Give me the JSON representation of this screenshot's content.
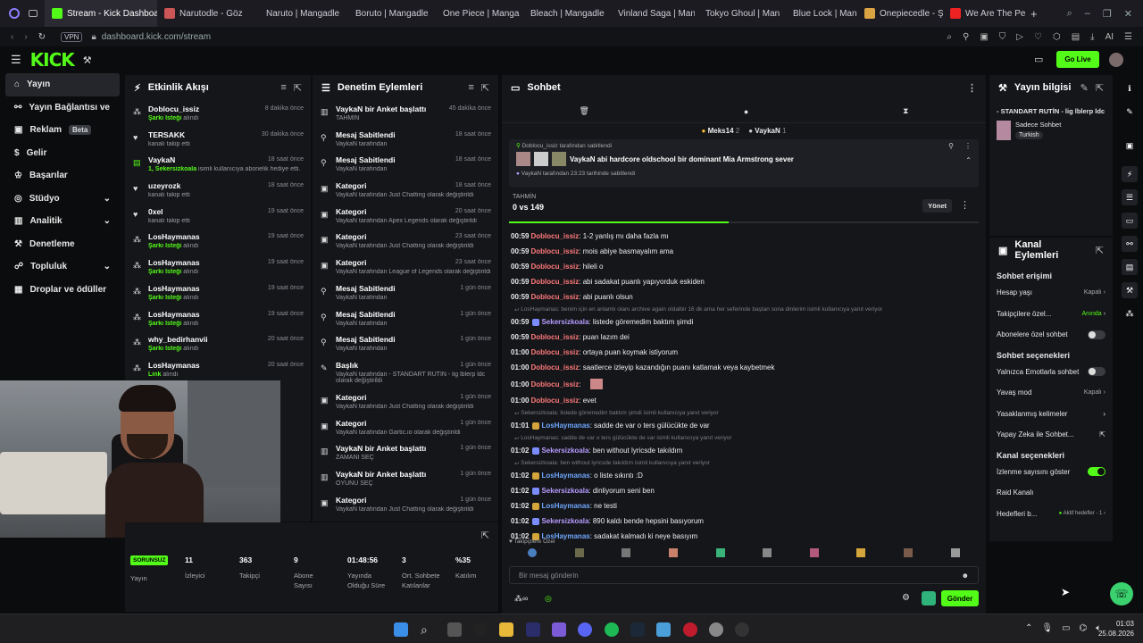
{
  "browser": {
    "tabs": [
      "Stream - Kick Dashboard",
      "Narutodle - Göz",
      "Naruto | Mangadle",
      "Boruto | Mangadle",
      "One Piece | Manga",
      "Bleach | Mangadle",
      "Vinland Saga | Man",
      "Tokyo Ghoul | Man",
      "Blue Lock | Manga",
      "Onepiecedle - Şey",
      "We Are The Pe"
    ],
    "vpn": "VPN",
    "url": "dashboard.kick.com/stream",
    "ai": "AI"
  },
  "header": {
    "logo": "KICK",
    "go_live": "Go Live"
  },
  "sidebar": {
    "items": [
      "Yayın",
      "Yayın Bağlantısı ve Anahtar",
      "Reklam",
      "Gelir",
      "Başarılar",
      "Stüdyo",
      "Analitik",
      "Denetleme",
      "Topluluk",
      "Droplar ve ödüller"
    ],
    "beta": "Beta"
  },
  "activity": {
    "title": "Etkinlik Akışı",
    "rows": [
      {
        "name": "Doblocu_issiz",
        "sub": "Şarkı İsteği",
        "suffix": " alındı",
        "time": "8 dakika önce"
      },
      {
        "name": "TERSAKK",
        "sub": "",
        "suffix": "kanalı takip etti",
        "time": "30 dakika önce"
      },
      {
        "name": "VaykaN",
        "sub": "1, Sekersizkoala",
        "suffix": " isimli kullanıcıya abonelik hediye etti.",
        "time": "18 saat önce"
      },
      {
        "name": "uzeyrozk",
        "sub": "",
        "suffix": "kanalı takip etti",
        "time": "18 saat önce"
      },
      {
        "name": "0xel",
        "sub": "",
        "suffix": "kanalı takip etti",
        "time": "19 saat önce"
      },
      {
        "name": "LosHaymanas",
        "sub": "Şarkı İsteği",
        "suffix": " alındı",
        "time": "19 saat önce"
      },
      {
        "name": "LosHaymanas",
        "sub": "Şarkı İsteği",
        "suffix": " alındı",
        "time": "19 saat önce"
      },
      {
        "name": "LosHaymanas",
        "sub": "Şarkı İsteği",
        "suffix": " alındı",
        "time": "19 saat önce"
      },
      {
        "name": "LosHaymanas",
        "sub": "Şarkı İsteği",
        "suffix": " alındı",
        "time": "19 saat önce"
      },
      {
        "name": "why_bedirhanvii",
        "sub": "Şarkı İsteği",
        "suffix": " alındı",
        "time": "20 saat önce"
      },
      {
        "name": "LosHaymanas",
        "sub": "Link",
        "suffix": " alındı",
        "time": "20 saat önce"
      }
    ]
  },
  "moderation": {
    "title": "Denetim Eylemleri",
    "rows": [
      {
        "title": "VaykaN bir Anket başlattı",
        "sub": "TAHMİN",
        "time": "45 dakika önce"
      },
      {
        "title": "Mesaj Sabitlendi",
        "sub": "VaykaN tarafından",
        "time": "18 saat önce"
      },
      {
        "title": "Mesaj Sabitlendi",
        "sub": "VaykaN tarafından",
        "time": "18 saat önce"
      },
      {
        "title": "Kategori",
        "sub": "VaykaN tarafından Just Chatting olarak değiştirildi",
        "time": "18 saat önce"
      },
      {
        "title": "Kategori",
        "sub": "VaykaN tarafından Apex Legends olarak değiştirildi",
        "time": "20 saat önce"
      },
      {
        "title": "Kategori",
        "sub": "VaykaN tarafından Just Chatting olarak değiştirildi",
        "time": "23 saat önce"
      },
      {
        "title": "Kategori",
        "sub": "VaykaN tarafından League of Legends olarak değiştirildi",
        "time": "23 saat önce"
      },
      {
        "title": "Mesaj Sabitlendi",
        "sub": "VaykaN tarafından",
        "time": "1 gün önce"
      },
      {
        "title": "Mesaj Sabitlendi",
        "sub": "VaykaN tarafından",
        "time": "1 gün önce"
      },
      {
        "title": "Mesaj Sabitlendi",
        "sub": "VaykaN tarafından",
        "time": "1 gün önce"
      },
      {
        "title": "Başlık",
        "sub": "VaykaN tarafından - STANDART RUTİN - lig lblerp ldc olarak değiştirildi",
        "time": "1 gün önce"
      },
      {
        "title": "Kategori",
        "sub": "VaykaN tarafından Just Chatting olarak değiştirildi",
        "time": "1 gün önce"
      },
      {
        "title": "Kategori",
        "sub": "VaykaN tarafından Gartic.io olarak değiştirildi",
        "time": "1 gün önce"
      },
      {
        "title": "VaykaN bir Anket başlattı",
        "sub": "ZAMANI SEÇ",
        "time": "1 gün önce"
      },
      {
        "title": "VaykaN bir Anket başlattı",
        "sub": "OYUNU SEÇ",
        "time": "1 gün önce"
      },
      {
        "title": "Kategori",
        "sub": "VaykaN tarafından Just Chatting olarak değiştirildi",
        "time": "1 gün önce"
      }
    ]
  },
  "chat": {
    "title": "Sohbet",
    "user_meks": "Meks14",
    "meks_count": "2",
    "user_vaykan": "VaykaN",
    "vaykan_count": "1",
    "pinned_by": "Doblocu_issiz tarafından sabitlendi",
    "pinned_msg": "VaykaN abi hardcore oldschool bir dominant Mia Armstrong sever",
    "pinned_when": "VaykaN tarafından 23:23 tarihinde sabitlendi",
    "poll_label": "TAHMİN",
    "poll_score": "0 vs 149",
    "poll_manage": "Yönet",
    "lines": [
      {
        "type": "msg",
        "ts": "00:59",
        "user": "Doblocu_issiz",
        "c": "u1",
        "text": ": 1-2 yanlış mı daha fazla mı"
      },
      {
        "type": "msg",
        "ts": "00:59",
        "user": "Doblocu_issiz",
        "c": "u1",
        "text": ": mois abiye basmayalım ama"
      },
      {
        "type": "msg",
        "ts": "00:59",
        "user": "Doblocu_issiz",
        "c": "u1",
        "text": ": hileli o"
      },
      {
        "type": "msg",
        "ts": "00:59",
        "user": "Doblocu_issiz",
        "c": "u1",
        "text": ": abi sadakat puanlı yapıyorduk eskiden"
      },
      {
        "type": "msg",
        "ts": "00:59",
        "user": "Doblocu_issiz",
        "c": "u1",
        "text": ": abi puanlı olsun"
      },
      {
        "type": "sys",
        "text": "LosHaymanas: benim için en anlamlı olanı archive again oldalbir 16 dk ama her seferinde baştan sona dinlerim isimli kullanıcıya yanıt veriyor"
      },
      {
        "type": "msg",
        "ts": "00:59",
        "user": "Sekersizkoala",
        "c": "u2",
        "text": ": listede göremedim baktım şimdi"
      },
      {
        "type": "msg",
        "ts": "00:59",
        "user": "Doblocu_issiz",
        "c": "u1",
        "text": ": puan lazım dei"
      },
      {
        "type": "msg",
        "ts": "01:00",
        "user": "Doblocu_issiz",
        "c": "u1",
        "text": ": ortaya puan koymak istiyorum"
      },
      {
        "type": "msg",
        "ts": "01:00",
        "user": "Doblocu_issiz",
        "c": "u1",
        "text": ": saatlerce izleyip kazandığın puanı katlamak veya kaybetmek"
      },
      {
        "type": "msg",
        "ts": "01:00",
        "user": "Doblocu_issiz",
        "c": "u1",
        "text": ":"
      },
      {
        "type": "msg",
        "ts": "01:00",
        "user": "Doblocu_issiz",
        "c": "u1",
        "text": ": evet"
      },
      {
        "type": "sys",
        "text": "Sekersizkoala: listede göremedim baktım şimdi isimli kullanıcıya yanıt veriyor"
      },
      {
        "type": "msg",
        "ts": "01:01",
        "user": "LosHaymanas",
        "c": "u3",
        "text": ": sadde de var o ters gülücükte de var"
      },
      {
        "type": "sys",
        "text": "LosHaymanas: sadde de var o ters gülücükte de var isimli kullanıcıya yanıt veriyor"
      },
      {
        "type": "msg",
        "ts": "01:02",
        "user": "Sekersizkoala",
        "c": "u2",
        "text": ": ben without lyricsde takıldım"
      },
      {
        "type": "sys",
        "text": "Sekersizkoala: ben without lyricsde takıldım isimli kullanıcıya yanıt veriyor"
      },
      {
        "type": "msg",
        "ts": "01:02",
        "user": "LosHaymanas",
        "c": "u3",
        "text": ": o liste sıkıntı :D"
      },
      {
        "type": "msg",
        "ts": "01:02",
        "user": "Sekersizkoala",
        "c": "u2",
        "text": ": dinliyorum seni ben"
      },
      {
        "type": "msg",
        "ts": "01:02",
        "user": "LosHaymanas",
        "c": "u3",
        "text": ": ne testi"
      },
      {
        "type": "msg",
        "ts": "01:02",
        "user": "Sekersizkoala",
        "c": "u2",
        "text": ": 890 kaldı bende hepsini basıyorum"
      },
      {
        "type": "msg",
        "ts": "01:02",
        "user": "LosHaymanas",
        "c": "u3",
        "text": ": sadakat kalmadı ki neye basıyım"
      }
    ],
    "followers_only": "Takipçilere Özel",
    "input_placeholder": "Bir mesaj gönderin",
    "send": "Gönder"
  },
  "stream_info": {
    "title": "Yayın bilgisi",
    "stream_title": "- STANDART RUTİN - lig lblerp ldc",
    "category": "Sadece Sohbet",
    "tag": "Turkish"
  },
  "channel_actions": {
    "title": "Kanal Eylemleri",
    "sec1": "Sohbet erişimi",
    "rows1": [
      {
        "label": "Hesap yaşı",
        "value": "Kapalı"
      },
      {
        "label": "Takipçilere özel...",
        "value": "Anında"
      },
      {
        "label": "Abonelere özel sohbet",
        "value": ""
      }
    ],
    "sec2": "Sohbet seçenekleri",
    "rows2": [
      {
        "label": "Yalnızca Emotlarla sohbet",
        "value": ""
      },
      {
        "label": "Yavaş mod",
        "value": "Kapalı"
      },
      {
        "label": "Yasaklanmış kelimeler",
        "value": ""
      },
      {
        "label": "Yapay Zeka ile Sohbet...",
        "value": ""
      }
    ],
    "sec3": "Kanal seçenekleri",
    "rows3": [
      {
        "label": "İzlenme sayısını göster",
        "value": ""
      },
      {
        "label": "Raid Kanalı",
        "value": ""
      },
      {
        "label": "Hedefleri b...",
        "value": "Aktif hedefler - 1"
      }
    ]
  },
  "stats": {
    "status": "SORUNSUZ",
    "status_label": "Yayın",
    "items": [
      {
        "v": "11",
        "l": "İzleyici"
      },
      {
        "v": "363",
        "l": "Takipçi"
      },
      {
        "v": "9",
        "l": "Abone Sayısı"
      },
      {
        "v": "01:48:56",
        "l": "Yayında Olduğu Süre"
      },
      {
        "v": "3",
        "l": "Ort. Sohbete Katılanlar"
      },
      {
        "v": "%35",
        "l": "Katılım"
      }
    ]
  },
  "taskbar": {
    "time": "01:03",
    "date": "25.08.2026"
  },
  "colors": {
    "accent": "#53fc18",
    "panel": "#15161a",
    "bg": "#0b0c0e"
  }
}
